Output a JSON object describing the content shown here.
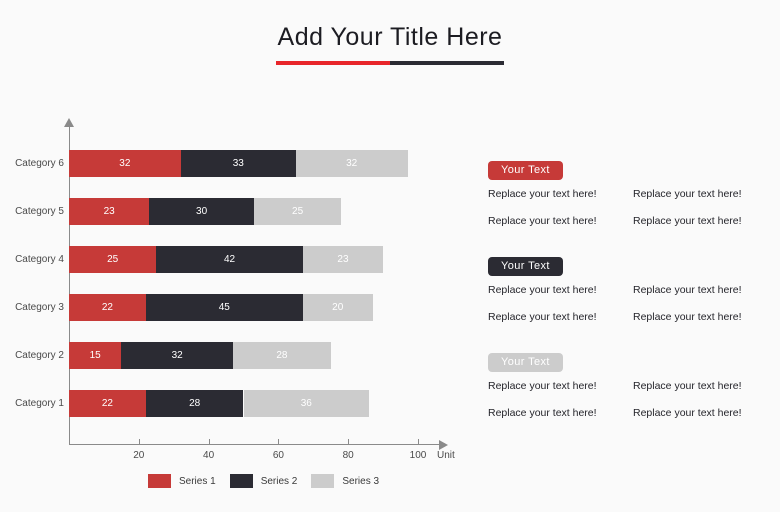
{
  "title": {
    "text": "Add Your Title Here",
    "rule_colors": [
      "#e8252a",
      "#2b2b33"
    ]
  },
  "chart_data": {
    "type": "bar",
    "orientation": "horizontal",
    "stacked": true,
    "title": "",
    "xlabel": "Unit",
    "ylabel": "",
    "xlim": [
      0,
      110
    ],
    "xticks": [
      20,
      40,
      60,
      80,
      100
    ],
    "grid": false,
    "legend_position": "bottom",
    "categories": [
      "Category 1",
      "Category 2",
      "Category 3",
      "Category 4",
      "Category 5",
      "Category 6"
    ],
    "series": [
      {
        "name": "Series 1",
        "color": "#c63a38",
        "values": [
          22,
          15,
          22,
          25,
          23,
          32
        ]
      },
      {
        "name": "Series 2",
        "color": "#2b2b33",
        "values": [
          28,
          32,
          45,
          42,
          30,
          33
        ]
      },
      {
        "name": "Series 3",
        "color": "#cccccc",
        "values": [
          36,
          28,
          20,
          23,
          25,
          32
        ]
      }
    ]
  },
  "axis": {
    "unit_label": "Unit",
    "tick_labels": [
      "20",
      "40",
      "60",
      "80",
      "100"
    ]
  },
  "right_panel": {
    "blocks": [
      {
        "badge": "Your Text",
        "badge_bg": "#c63a38",
        "badge_color": "#ffffff",
        "rows": [
          [
            "Replace your text here!",
            "Replace your text here!"
          ],
          [
            "Replace your text here!",
            "Replace your text here!"
          ]
        ]
      },
      {
        "badge": "Your Text",
        "badge_bg": "#2b2b33",
        "badge_color": "#ffffff",
        "rows": [
          [
            "Replace your text here!",
            "Replace your text here!"
          ],
          [
            "Replace your text here!",
            "Replace your text here!"
          ]
        ]
      },
      {
        "badge": "Your Text",
        "badge_bg": "#cccccc",
        "badge_color": "#ffffff",
        "rows": [
          [
            "Replace your text here!",
            "Replace your text here!"
          ],
          [
            "Replace your text here!",
            "Replace your text here!"
          ]
        ]
      }
    ]
  }
}
